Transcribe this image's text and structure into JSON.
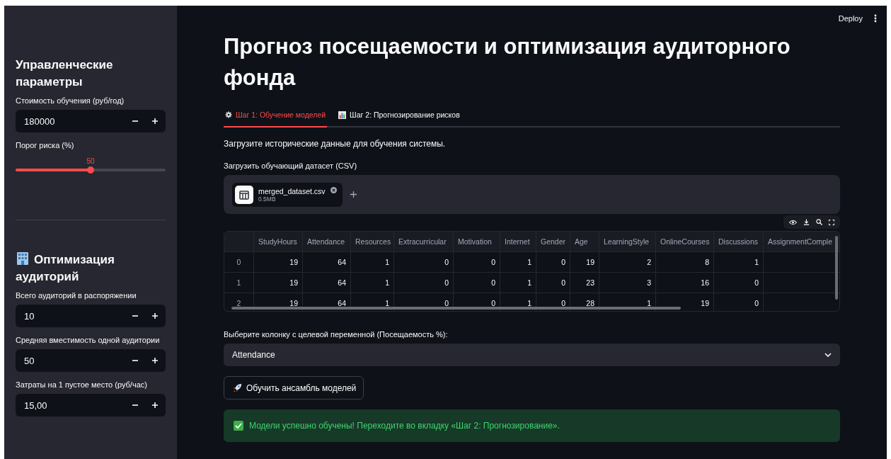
{
  "header": {
    "deploy": "Deploy"
  },
  "sidebar": {
    "sections": [
      {
        "title": "Управленческие параметры",
        "fields": [
          {
            "kind": "number",
            "label": "Стоимость обучения (руб/год)",
            "value": "180000"
          },
          {
            "kind": "slider",
            "label": "Порог риска (%)",
            "reading": "50",
            "level": 0.5
          }
        ]
      },
      {
        "title": "Оптимизация аудиторий",
        "fields": [
          {
            "kind": "number",
            "label": "Всего аудиторий в распоряжении",
            "value": "10"
          },
          {
            "kind": "number",
            "label": "Средняя вместимость одной аудитории",
            "value": "50"
          },
          {
            "kind": "number",
            "label": "Затраты на 1 пустое место (руб/час)",
            "value": "15,00"
          }
        ]
      }
    ]
  },
  "main": {
    "title": "Прогноз посещаемости и оптимизация аудиторного фонда",
    "tabs": [
      {
        "label": "Шаг 1: Обучение моделей",
        "selected": true
      },
      {
        "label": "Шаг 2: Прогнозирование рисков",
        "selected": false
      }
    ],
    "intro": "Загрузите исторические данные для обучения системы.",
    "uploader": {
      "label": "Загрузить обучающий датасет (CSV)",
      "file_name": "merged_dataset.csv",
      "file_size": "0.5MB"
    },
    "table": {
      "columns": [
        "",
        "StudyHours",
        "Attendance",
        "Resources",
        "Extracurricular",
        "Motivation",
        "Internet",
        "Gender",
        "Age",
        "LearningStyle",
        "OnlineCourses",
        "Discussions",
        "AssignmentComple"
      ],
      "rows": [
        [
          "0",
          "19",
          "64",
          "1",
          "0",
          "0",
          "1",
          "0",
          "19",
          "2",
          "8",
          "1"
        ],
        [
          "1",
          "19",
          "64",
          "1",
          "0",
          "0",
          "1",
          "0",
          "23",
          "3",
          "16",
          "0"
        ],
        [
          "2",
          "19",
          "64",
          "1",
          "0",
          "0",
          "1",
          "0",
          "28",
          "1",
          "19",
          "0"
        ]
      ]
    },
    "select": {
      "label": "Выберите колонку с целевой переменной (Посещаемость %):",
      "value": "Attendance"
    },
    "train_button": "Обучить ансамбль моделей",
    "success": "Модели успешно обучены! Переходите во вкладку «Шаг 2: Прогнозирование»."
  }
}
